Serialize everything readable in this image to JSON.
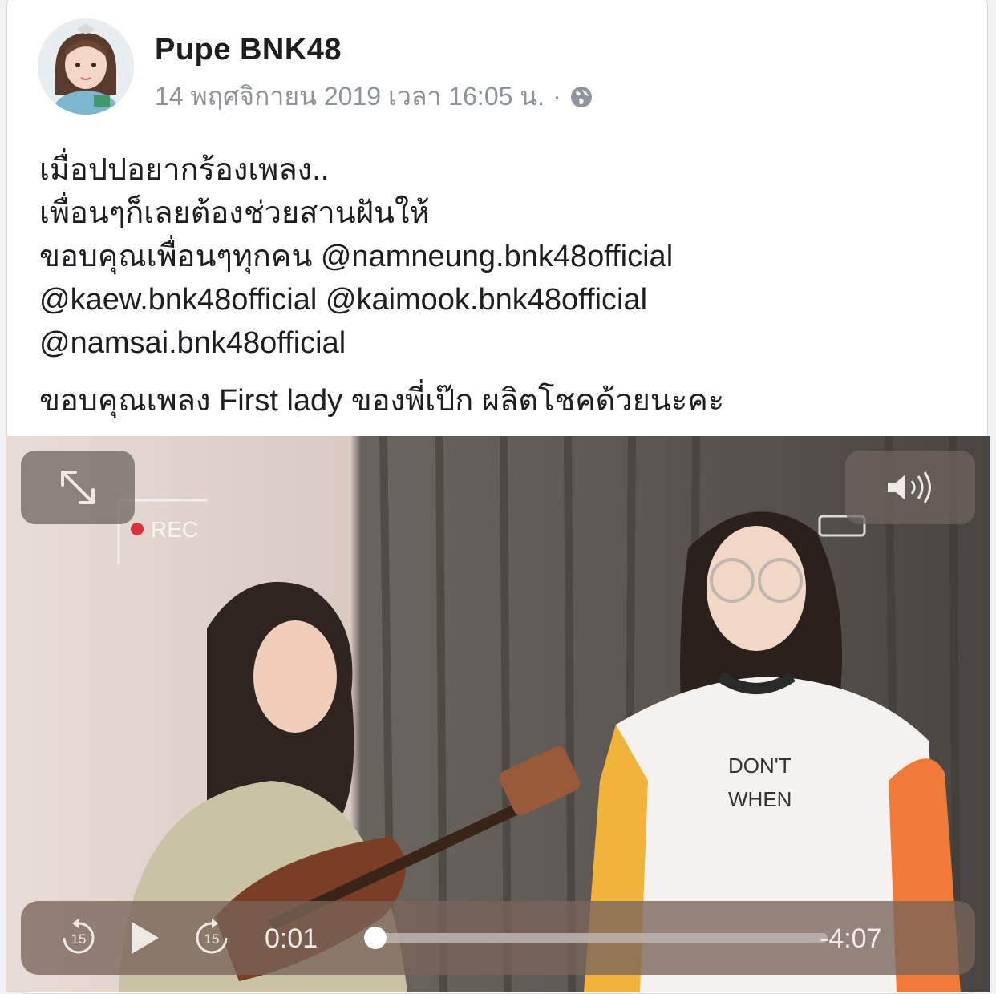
{
  "post": {
    "author": "Pupe BNK48",
    "timestamp": "14 พฤศจิกายน 2019 เวลา 16:05 น.",
    "separator": "·",
    "privacy_icon": "globe-icon",
    "text_lines": [
      "เมื่อปปอยากร้องเพลง..",
      "เพื่อนๆก็เลยต้องช่วยสานฝันให้",
      "ขอบคุณเพื่อนๆทุกคน @namneung.bnk48official",
      "@kaew.bnk48official @kaimook.bnk48official",
      "@namsai.bnk48official"
    ],
    "closing_line": "ขอบคุณเพลง First lady ของพี่เป๊ก ผลิตโชคด้วยนะคะ"
  },
  "video": {
    "overlay_text": "REC",
    "shirt_text_1": "DON'T",
    "shirt_text_2": "WHEN",
    "current_time": "0:01",
    "remaining_time": "-4:07",
    "progress": 0.01,
    "skip_back_label": "15",
    "skip_forward_label": "15",
    "icons": [
      "expand-icon",
      "volume-icon",
      "skip-back-15-icon",
      "play-icon",
      "skip-forward-15-icon"
    ]
  },
  "colors": {
    "author": "#1c1e21",
    "meta": "#8d949e",
    "control_bar": "#786459"
  }
}
